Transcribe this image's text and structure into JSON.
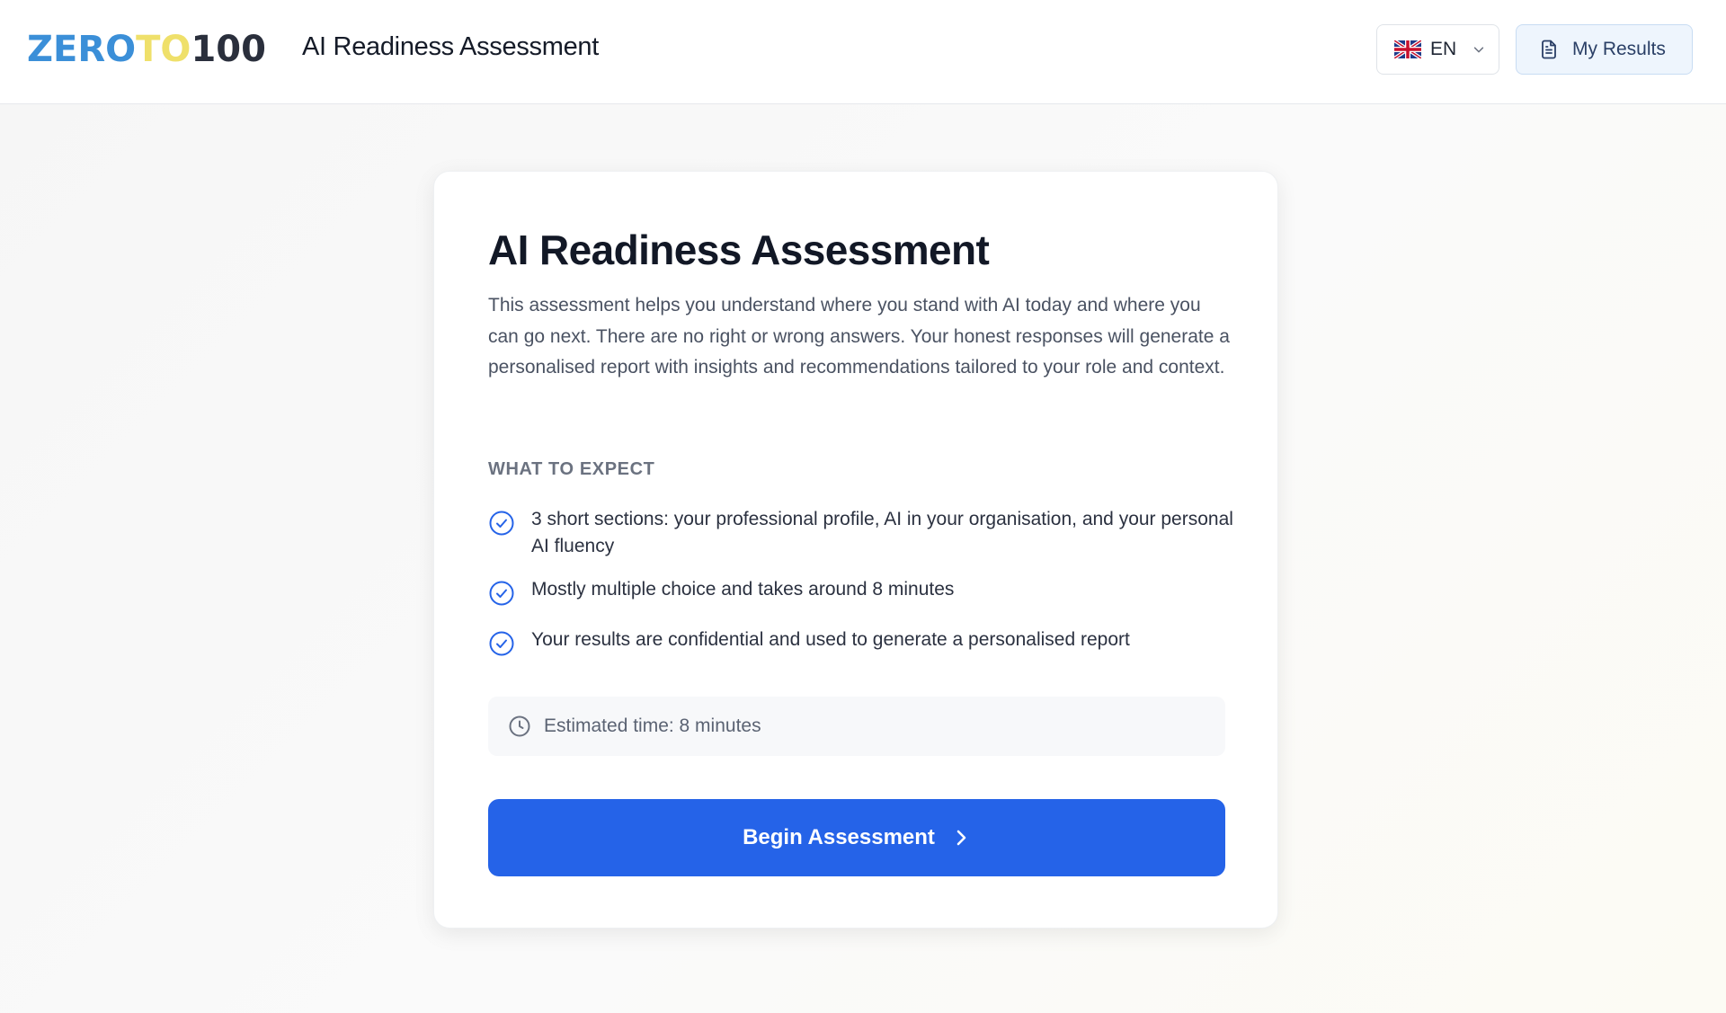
{
  "header": {
    "logo": {
      "part1": "ZERO",
      "part2": "TO",
      "part3": "100"
    },
    "app_title": "AI Readiness Assessment",
    "language": {
      "code": "EN",
      "flag_icon": "uk-flag-icon"
    },
    "results_button": {
      "label": "My Results",
      "icon": "document-icon"
    }
  },
  "card": {
    "title": "AI Readiness Assessment",
    "intro": "This assessment helps you understand where you stand with AI today and where you can go next. There are no right or wrong answers. Your honest responses will generate a personalised report with insights and recommendations tailored to your role and context.",
    "expect_label": "WHAT TO EXPECT",
    "expect_items": [
      "3 short sections: your professional profile, AI in your organisation, and your personal AI fluency",
      "Mostly multiple choice and takes around 8 minutes",
      "Your results are confidential and used to generate a personalised report"
    ],
    "estimate": {
      "text": "Estimated time: 8 minutes",
      "icon": "clock-icon"
    },
    "begin_button": {
      "label": "Begin Assessment",
      "icon": "chevron-right-icon"
    }
  },
  "colors": {
    "accent": "#2563e8",
    "logo_blue": "#3b8fd8",
    "logo_yellow": "#efe06a",
    "logo_dark": "#2a2f3c",
    "results_bg": "#eef5fd"
  }
}
